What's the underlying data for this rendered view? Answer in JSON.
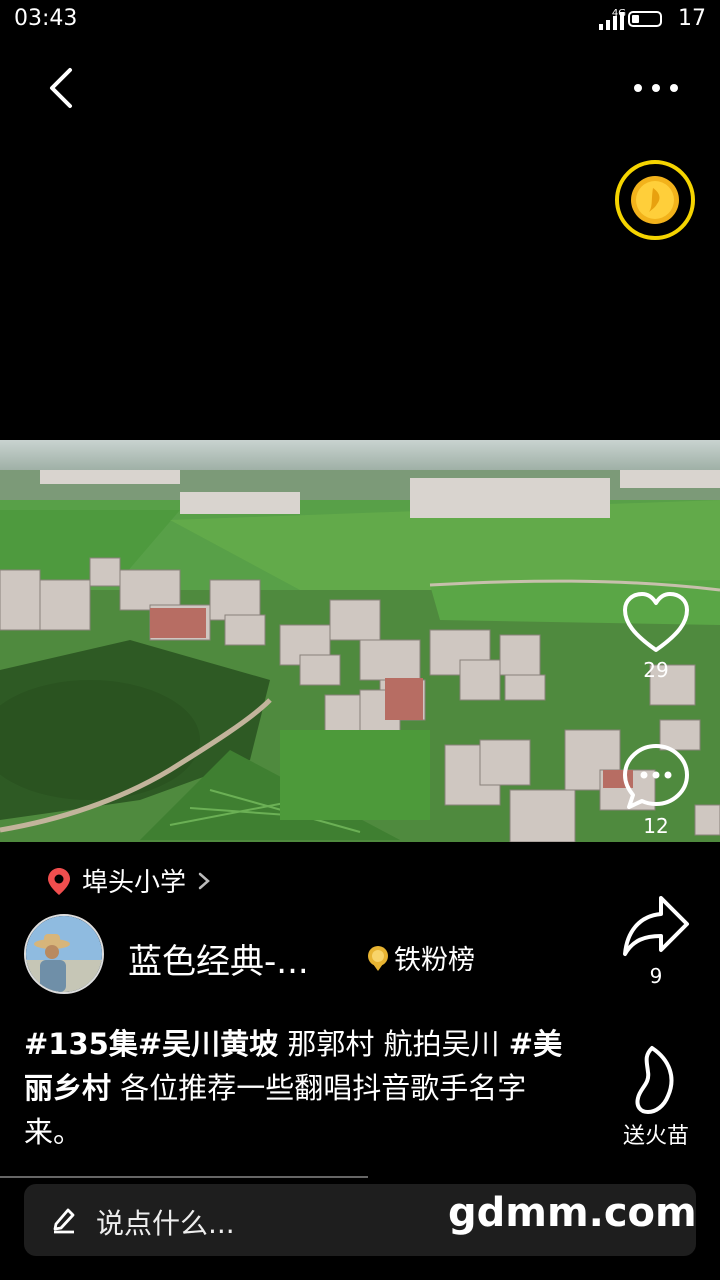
{
  "status_bar": {
    "time": "03:43",
    "network": "4G",
    "battery": "17"
  },
  "icons": {
    "back": "back-chevron-icon",
    "more": "more-dots-icon",
    "coin": "gold-coin-icon",
    "like": "heart-icon",
    "comment": "comment-icon",
    "share": "share-arrow-icon",
    "flame": "flame-icon",
    "location": "location-pin-icon",
    "medal": "medal-icon",
    "pen": "pen-icon"
  },
  "actions": {
    "like_count": "29",
    "comment_count": "12",
    "share_count": "9",
    "gift_label": "送火苗"
  },
  "location": {
    "label": "埠头小学"
  },
  "author": {
    "name": "蓝色经典-...",
    "fans_rank_label": "铁粉榜"
  },
  "caption": {
    "tag1": "#135集#吴川黄坡",
    "text1": " 那郭村 航拍吴川 ",
    "tag2": "#美丽乡村",
    "text2": " 各位推荐一些翻唱抖音歌手名字来。"
  },
  "comment_input": {
    "placeholder": "说点什么..."
  },
  "watermark": "gdmm.com",
  "colors": {
    "coin_ring": "#f5d400",
    "pin": "#f04e4e",
    "background": "#000000"
  }
}
